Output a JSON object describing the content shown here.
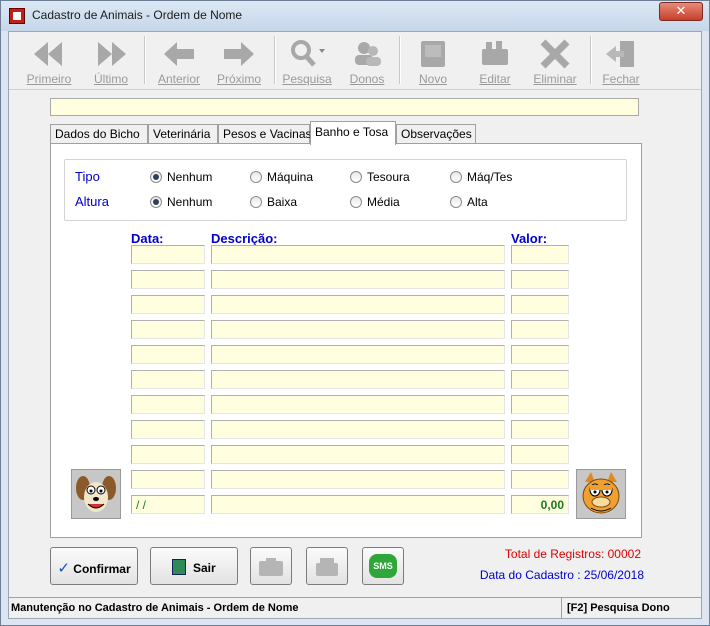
{
  "window": {
    "title": "Cadastro de Animais - Ordem de Nome",
    "close_label": "✕"
  },
  "toolbar": {
    "primeiro": "Primeiro",
    "ultimo": "Último",
    "anterior": "Anterior",
    "proximo": "Próximo",
    "pesquisa": "Pesquisa",
    "donos": "Donos",
    "novo": "Novo",
    "editar": "Editar",
    "eliminar": "Eliminar",
    "fechar": "Fechar"
  },
  "top_field": {
    "value": ""
  },
  "tabs": [
    {
      "label": "Dados do Bicho"
    },
    {
      "label": "Veterinária"
    },
    {
      "label": "Pesos e Vacinas"
    },
    {
      "label": "Banho e Tosa"
    },
    {
      "label": "Observações"
    }
  ],
  "active_tab": "Banho e Tosa",
  "options": {
    "tipo_label": "Tipo",
    "tipo": [
      "Nenhum",
      "Máquina",
      "Tesoura",
      "Máq/Tes"
    ],
    "tipo_selected": "Nenhum",
    "altura_label": "Altura",
    "altura": [
      "Nenhum",
      "Baixa",
      "Média",
      "Alta"
    ],
    "altura_selected": "Nenhum"
  },
  "grid": {
    "headers": {
      "data": "Data:",
      "descricao": "Descrição:",
      "valor": "Valor:"
    },
    "rows": [
      {
        "data": "",
        "descricao": "",
        "valor": ""
      },
      {
        "data": "",
        "descricao": "",
        "valor": ""
      },
      {
        "data": "",
        "descricao": "",
        "valor": ""
      },
      {
        "data": "",
        "descricao": "",
        "valor": ""
      },
      {
        "data": "",
        "descricao": "",
        "valor": ""
      },
      {
        "data": "",
        "descricao": "",
        "valor": ""
      },
      {
        "data": "",
        "descricao": "",
        "valor": ""
      },
      {
        "data": "",
        "descricao": "",
        "valor": ""
      },
      {
        "data": "",
        "descricao": "",
        "valor": ""
      },
      {
        "data": "",
        "descricao": "",
        "valor": ""
      }
    ],
    "entry_row": {
      "data": " / /",
      "descricao": "",
      "valor": "0,00"
    }
  },
  "buttons": {
    "confirmar": "Confirmar",
    "sair": "Sair",
    "sms": "SMS"
  },
  "info": {
    "total_registros": "Total de Registros: 00002",
    "data_cadastro": "Data do Cadastro : 25/06/2018",
    "total_color": "#e00000",
    "data_color": "#0000cc"
  },
  "status": {
    "left": "Manutenção no Cadastro de Animais - Ordem de Nome",
    "right": "[F2] Pesquisa Dono"
  }
}
